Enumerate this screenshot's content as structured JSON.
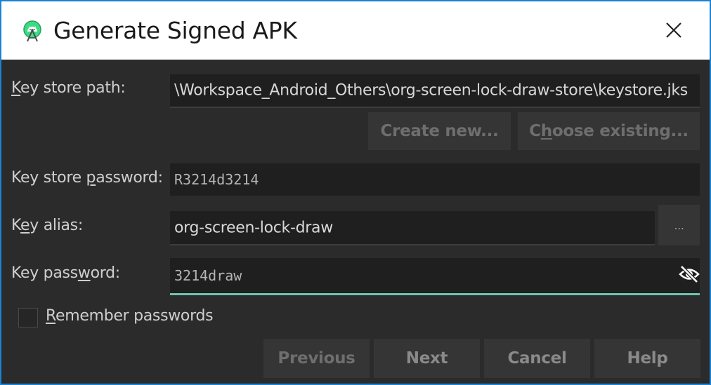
{
  "window": {
    "title": "Generate Signed APK",
    "icon": "android-studio-icon",
    "close_icon": "close-icon"
  },
  "form": {
    "keystore_path": {
      "label_prefix": "K",
      "label_rest": "ey store path:",
      "value": "\\Workspace_Android_Others\\org-screen-lock-draw-store\\keystore.jks"
    },
    "create_new_label": "Create new...",
    "choose_existing": {
      "before": "C",
      "mnemonic": "h",
      "after": "oose existing..."
    },
    "keystore_password": {
      "label_before": "Key store ",
      "label_mnemonic": "p",
      "label_after": "assword:",
      "value": "R3214d3214"
    },
    "key_alias": {
      "label_before": "K",
      "label_mnemonic": "e",
      "label_after": "y alias:",
      "value": "org-screen-lock-draw",
      "browse_label": "..."
    },
    "key_password": {
      "label_before": "Key pass",
      "label_mnemonic": "w",
      "label_after": "ord:",
      "value": "3214draw",
      "toggle_icon": "eye-slash-icon"
    },
    "remember": {
      "mnemonic": "R",
      "label_rest": "emember passwords",
      "checked": false
    }
  },
  "buttons": {
    "previous": "Previous",
    "next": "Next",
    "cancel": "Cancel",
    "help": "Help"
  },
  "colors": {
    "window_border": "#1883d7",
    "background": "#2b2b2b",
    "focus_underline": "#6ac5b0"
  }
}
